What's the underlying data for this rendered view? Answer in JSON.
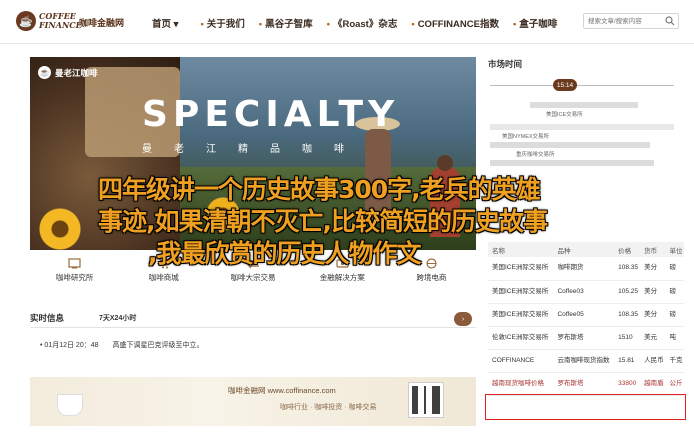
{
  "header": {
    "logo_mark": "☕",
    "logo_line1": "COFFEE",
    "logo_line2": "FINANCE",
    "site_name": "咖啡金融网",
    "nav": [
      {
        "label": "首页",
        "arrow": "▾"
      },
      {
        "label": "关于我们"
      },
      {
        "label": "黑谷子智库"
      },
      {
        "label": "《Roast》杂志"
      },
      {
        "label": "COFFINANCE指数"
      },
      {
        "label": "盒子咖啡"
      }
    ],
    "search_placeholder": "搜索文章/搜索内容"
  },
  "banner": {
    "badge": "曼老江咖啡",
    "headline": "SPECIALTY",
    "subline": "曼老江精品咖啡"
  },
  "quick_links": [
    {
      "label": "咖啡研究所",
      "icon": "microscope-icon"
    },
    {
      "label": "咖啡商城",
      "icon": "cart-icon"
    },
    {
      "label": "咖啡大宗交易",
      "icon": "exchange-icon"
    },
    {
      "label": "金融解决方案",
      "icon": "finance-icon"
    },
    {
      "label": "跨境电商",
      "icon": "globe-icon"
    }
  ],
  "realtime": {
    "title": "实时信息",
    "subtitle": "7天X24小时",
    "more": "更多",
    "items": [
      {
        "time": "01月12日 20：48",
        "text": "高盛下调星巴克评级至中立。"
      }
    ]
  },
  "promo": {
    "line1": "咖啡金融网  www.coffinance.com",
    "line2": "咖啡行业 · 咖啡投资 · 咖啡交易"
  },
  "sidebar": {
    "market_time_title": "市场时间",
    "timeline_marker": "15:14",
    "timeline_labels": [
      "美国ICE交易所",
      "美国NYMEX交易所",
      "重庆咖啡交易所",
      "云南咖啡交易中心",
      "巴西BMF交易所"
    ],
    "table": {
      "headers": [
        "名称",
        "品种",
        "价格",
        "货币",
        "单位"
      ],
      "rows": [
        [
          "美国ICE洲际交易所",
          "咖啡期货",
          "108.35",
          "美分",
          "磅"
        ],
        [
          "美国ICE洲际交易所",
          "Coffee03",
          "105.25",
          "美分",
          "磅"
        ],
        [
          "美国ICE洲际交易所",
          "Coffee05",
          "108.35",
          "美分",
          "磅"
        ],
        [
          "伦敦ICE洲际交易所",
          "罗布斯塔",
          "1510",
          "美元",
          "吨"
        ],
        [
          "COFFINANCE",
          "云南咖啡现货指数",
          "15.81",
          "人民币",
          "千克"
        ],
        [
          "越南现货咖啡价格",
          "罗布斯塔",
          "33800",
          "越南盾",
          "公斤"
        ]
      ]
    }
  },
  "overlay": {
    "line1": "四年级讲一个历史故事300字,老兵的英雄",
    "line2": "事迹,如果清朝不灭亡,比较简短的历史故事",
    "line3": ",我最欣赏的历史人物作文"
  }
}
